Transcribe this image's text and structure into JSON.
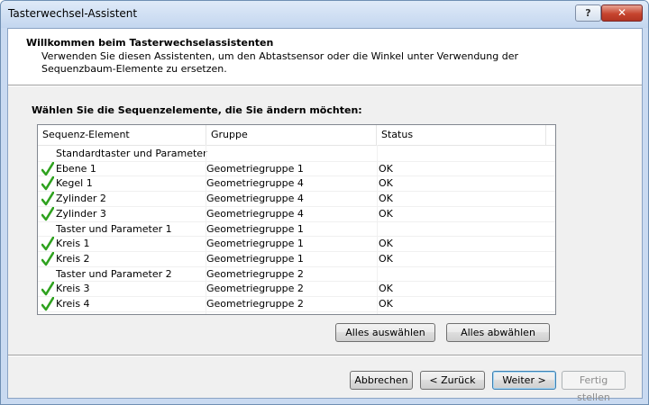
{
  "window": {
    "title": "Tasterwechsel-Assistent",
    "help_label": "?",
    "close_label": "✕"
  },
  "header": {
    "title": "Willkommen beim Tasterwechselassistenten",
    "description": "Verwenden Sie diesen Assistenten, um den Abtastsensor oder die Winkel unter Verwendung der Sequenzbaum-Elemente zu ersetzen."
  },
  "section_label": "Wählen Sie die Sequenzelemente, die Sie ändern möchten:",
  "list": {
    "columns": [
      "Sequenz-Element",
      "Gruppe",
      "Status"
    ],
    "rows": [
      {
        "name": "Standardtaster und Parameter",
        "group": "",
        "status": "",
        "checked": false
      },
      {
        "name": "Ebene 1",
        "group": "Geometriegruppe 1",
        "status": "OK",
        "checked": true
      },
      {
        "name": "Kegel 1",
        "group": "Geometriegruppe 4",
        "status": "OK",
        "checked": true
      },
      {
        "name": "Zylinder 2",
        "group": "Geometriegruppe 4",
        "status": "OK",
        "checked": true
      },
      {
        "name": "Zylinder 3",
        "group": "Geometriegruppe 4",
        "status": "OK",
        "checked": true
      },
      {
        "name": "Taster und Parameter 1",
        "group": "Geometriegruppe 1",
        "status": "",
        "checked": false
      },
      {
        "name": "Kreis 1",
        "group": "Geometriegruppe 1",
        "status": "OK",
        "checked": true
      },
      {
        "name": "Kreis 2",
        "group": "Geometriegruppe 1",
        "status": "OK",
        "checked": true
      },
      {
        "name": "Taster und Parameter 2",
        "group": "Geometriegruppe 2",
        "status": "",
        "checked": false
      },
      {
        "name": "Kreis 3",
        "group": "Geometriegruppe 2",
        "status": "OK",
        "checked": true
      },
      {
        "name": "Kreis 4",
        "group": "Geometriegruppe 2",
        "status": "OK",
        "checked": true
      }
    ],
    "check_color": "#2fa21f"
  },
  "buttons": {
    "select_all": "Alles auswählen",
    "deselect_all": "Alles abwählen",
    "cancel": "Abbrechen",
    "back": "< Zurück",
    "next": "Weiter >",
    "finish": "Fertig stellen"
  }
}
